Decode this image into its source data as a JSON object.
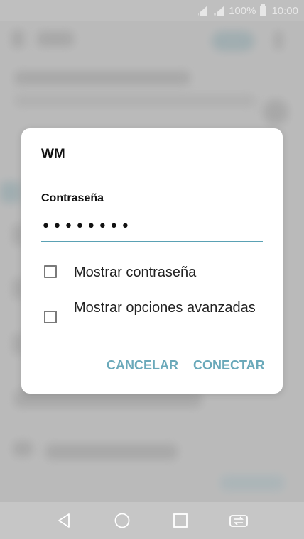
{
  "status_bar": {
    "battery": "100%",
    "time": "10:00",
    "icons": [
      "signal-icon",
      "signal-icon",
      "battery-icon"
    ]
  },
  "dialog": {
    "network_name": "WM",
    "password_label": "Contraseña",
    "password_value": "••••••••",
    "options": [
      {
        "label": "Mostrar contraseña",
        "checked": false
      },
      {
        "label": "Mostrar opciones avanzadas",
        "checked": false
      }
    ],
    "cancel_label": "CANCELAR",
    "connect_label": "CONECTAR",
    "accent_color": "#6aa9ba"
  },
  "nav_bar": {
    "icons": [
      "back-icon",
      "home-icon",
      "recents-icon",
      "dual-window-icon"
    ]
  }
}
